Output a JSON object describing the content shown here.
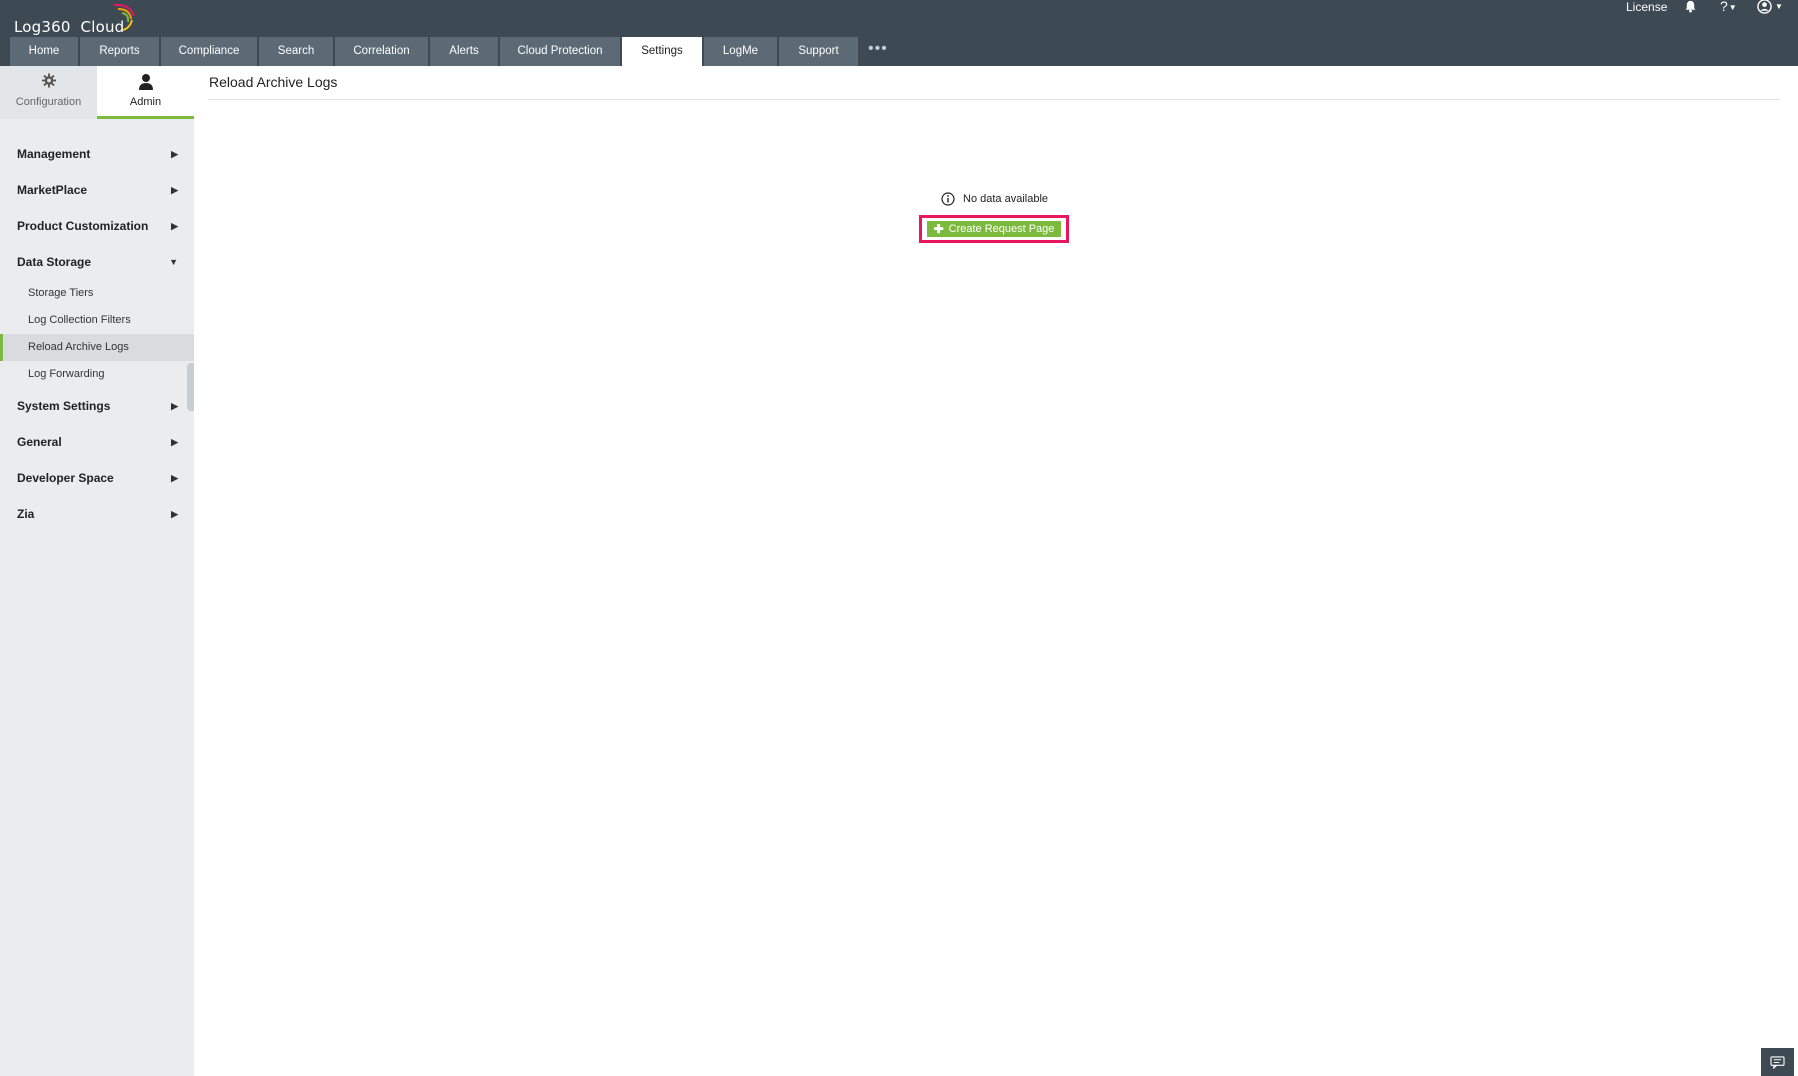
{
  "app": {
    "logo_text": "Log360  Cloud",
    "accent_color": "#7cba3d",
    "header_color": "#3e4a53",
    "highlight_color": "#e8175d"
  },
  "header": {
    "license_label": "License",
    "help_label": "?",
    "icons": [
      "bell-icon",
      "help-icon",
      "user-icon"
    ]
  },
  "tabs": [
    {
      "label": "Home",
      "active": false
    },
    {
      "label": "Reports",
      "active": false
    },
    {
      "label": "Compliance",
      "active": false
    },
    {
      "label": "Search",
      "active": false
    },
    {
      "label": "Correlation",
      "active": false
    },
    {
      "label": "Alerts",
      "active": false
    },
    {
      "label": "Cloud Protection",
      "active": false
    },
    {
      "label": "Settings",
      "active": true
    },
    {
      "label": "LogMe",
      "active": false
    },
    {
      "label": "Support",
      "active": false
    }
  ],
  "tab_more_label": "•••",
  "modes": {
    "configuration": {
      "label": "Configuration",
      "icon": "gear-icon"
    },
    "admin": {
      "label": "Admin",
      "icon": "user-icon",
      "active": true
    }
  },
  "sidebar": {
    "groups": [
      {
        "label": "Management",
        "expanded": false
      },
      {
        "label": "MarketPlace",
        "expanded": false
      },
      {
        "label": "Product Customization",
        "expanded": false
      },
      {
        "label": "Data Storage",
        "expanded": true,
        "items": [
          {
            "label": "Storage Tiers"
          },
          {
            "label": "Log Collection Filters"
          },
          {
            "label": "Reload Archive Logs",
            "active": true
          },
          {
            "label": "Log Forwarding"
          }
        ]
      },
      {
        "label": "System Settings",
        "expanded": false
      },
      {
        "label": "General",
        "expanded": false
      },
      {
        "label": "Developer Space",
        "expanded": false
      },
      {
        "label": "Zia",
        "expanded": false
      }
    ]
  },
  "main": {
    "title": "Reload Archive Logs",
    "empty_message": "No data available",
    "create_button_label": "Create Request Page"
  }
}
